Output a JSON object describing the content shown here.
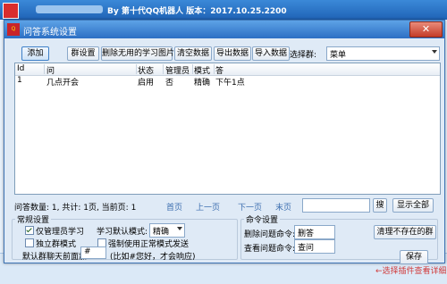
{
  "main_window": {
    "title": "By 第十代QQ机器人  版本：2017.10.25.2200"
  },
  "dialog": {
    "title": "问答系统设置",
    "close_glyph": "✕"
  },
  "toolbar": {
    "add": "添加",
    "group_set": "群设置",
    "delete_unused_images": "删除无用的学习图片",
    "clear_data": "清空数据",
    "export_data": "导出数据",
    "import_data": "导入数据",
    "select_group_label": "选择群:",
    "select_group_value": "菜单"
  },
  "table": {
    "columns": [
      "Id",
      "问",
      "状态",
      "管理员",
      "模式",
      "答"
    ],
    "rows": [
      {
        "id": "1",
        "question": "几点开会",
        "status": "启用",
        "admin": "否",
        "mode": "精确",
        "answer": "下午1点"
      }
    ]
  },
  "pager": {
    "summary": "问答数量: 1, 共计: 1页, 当前页: 1",
    "first": "首页",
    "prev": "上一页",
    "next": "下一页",
    "last": "末页",
    "search_button": "搜",
    "show_all": "显示全部"
  },
  "general_settings": {
    "title": "常规设置",
    "admin_only_label": "仅管理员学习",
    "admin_only_checked": true,
    "learn_mode_label": "学习默认模式:",
    "learn_mode_value": "精确",
    "independent_group_label": "独立群模式",
    "independent_group_checked": false,
    "force_normal_label": "强制使用正常模式发送",
    "force_normal_checked": false,
    "prefix_label": "默认群聊天前面加",
    "prefix_value": "#",
    "prefix_hint": "(比如#您好，才会响应)"
  },
  "command_settings": {
    "title": "命令设置",
    "delete_label": "删除问题命令:",
    "delete_value": "删答",
    "view_label": "查看问题命令:",
    "view_value": "查问",
    "clean_button": "清理不存在的群",
    "save_button": "保存"
  },
  "footer": {
    "hint": "←选择插件查看详细"
  }
}
